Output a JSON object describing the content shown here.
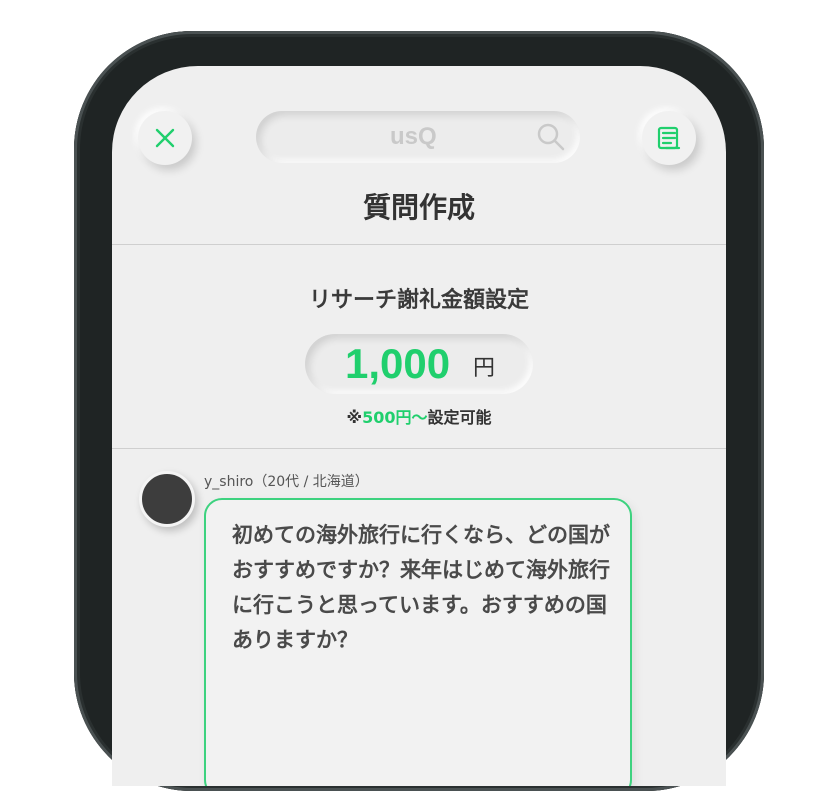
{
  "header": {
    "search_text": "usQ",
    "close_icon": "close-icon",
    "search_icon": "search-icon",
    "menu_icon": "menu-lines-icon",
    "accent_color": "#20cf6d"
  },
  "page": {
    "title": "質問作成"
  },
  "reward": {
    "label": "リサーチ謝礼金額設定",
    "amount": "1,000",
    "unit": "円",
    "note_prefix": "※",
    "note_minimum": "500円〜",
    "note_suffix_1": "設定",
    "note_suffix_2": "可能"
  },
  "message": {
    "username": "y_shiro（20代 / 北海道）",
    "text": "初めての海外旅行に行くなら、どの国がおすすめですか？来年はじめて海外旅行に行こうと思っています。おすすめの国ありますか？"
  }
}
